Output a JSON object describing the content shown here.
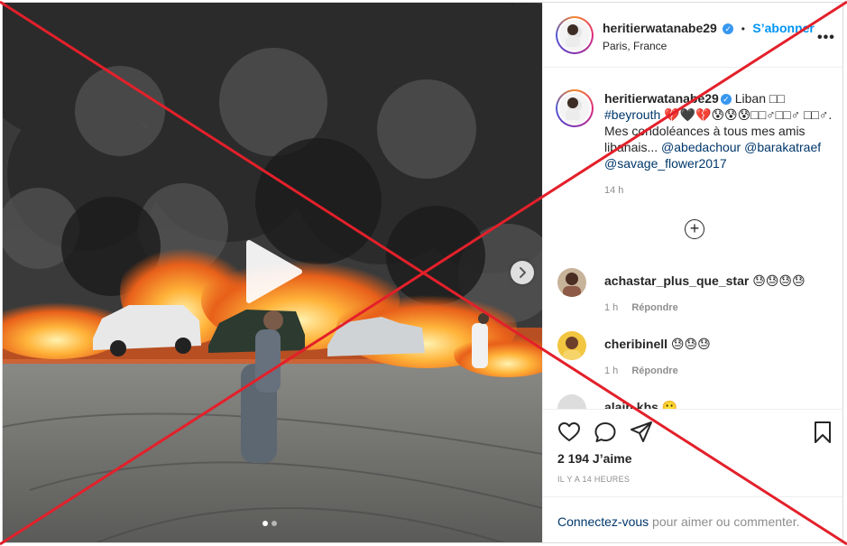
{
  "post": {
    "author": {
      "username": "heritierwatanabe29",
      "verified_icon": "verified-badge-icon",
      "location": "Paris, France",
      "follow_label": "S’abonner",
      "separator": "•"
    },
    "more_label": "•••",
    "caption": {
      "username": "heritierwatanabe29",
      "line1": "Liban \u0000\u0000",
      "text_parts": [
        {
          "type": "text",
          "value": " Liban □□"
        },
        {
          "type": "hashtag",
          "value": "#beyrouth"
        },
        {
          "type": "text",
          "value": " 💔🖤💔😰😰😰□□♂□□♂ □□♂. Mes condoléances à tous mes amis libanais... "
        },
        {
          "type": "mention",
          "value": "@abedachour"
        },
        {
          "type": "mention",
          "value": "@barakatraef"
        },
        {
          "type": "mention",
          "value": "@savage_flower2017"
        }
      ],
      "time": "14 h"
    },
    "load_more_icon": "plus-circle-icon",
    "comments": [
      {
        "username": "achastar_plus_que_star",
        "text": "😓😓😓😓",
        "time": "1 h",
        "reply": "Répondre"
      },
      {
        "username": "cheribinell",
        "text": "😓😓😓",
        "time": "1 h",
        "reply": "Répondre"
      },
      {
        "username": "alain.kbs",
        "text": "🙁",
        "time": "",
        "reply": ""
      }
    ],
    "likes": "2 194 J’aime",
    "posted_ago": "IL Y A 14 HEURES",
    "login_prompt": {
      "link": "Connectez-vous",
      "rest": " pour aimer ou commenter."
    },
    "media": {
      "play_icon": "play-icon",
      "next_icon": "chevron-right-icon",
      "dot_count": 2
    },
    "colors": {
      "link_blue": "#0095f6",
      "overlay_red": "#e3202a",
      "text": "#262626",
      "muted": "#8e8e8e"
    }
  }
}
